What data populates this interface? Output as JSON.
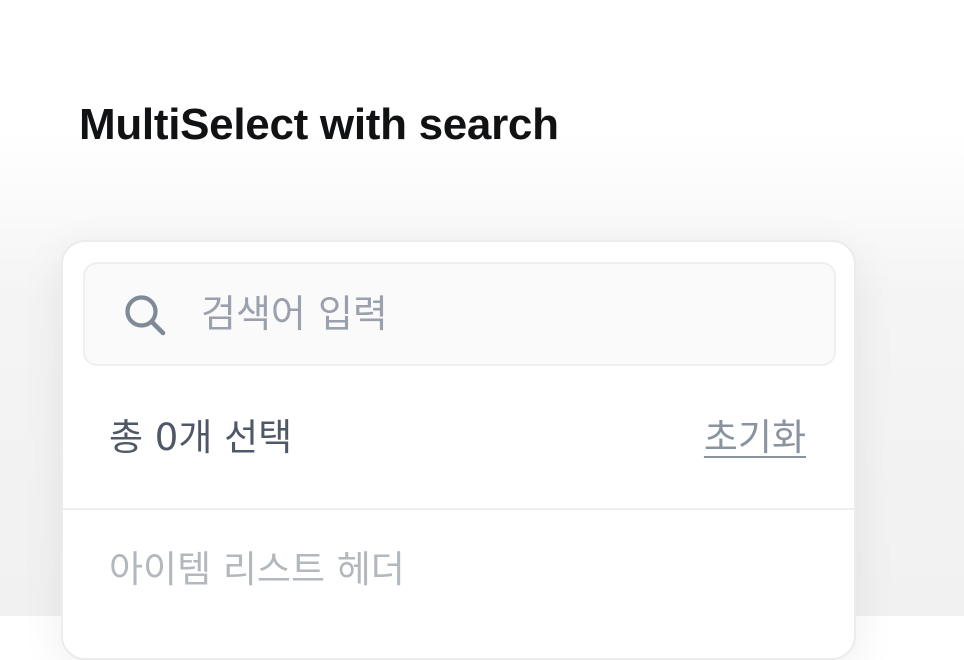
{
  "page": {
    "title": "MultiSelect with search"
  },
  "search": {
    "placeholder": "검색어 입력",
    "value": "",
    "icon": "search-icon"
  },
  "summary": {
    "selected_text": "총 0개 선택",
    "selected_count": 0,
    "reset_label": "초기화"
  },
  "list": {
    "header": "아이템 리스트 헤더",
    "items": []
  },
  "colors": {
    "title": "#111214",
    "placeholder": "#9aa1ad",
    "summary_text": "#4e5867",
    "reset_link": "#8a93a0",
    "list_header": "#b3b7be",
    "panel_border": "#ececec",
    "search_bg": "#fafafa"
  }
}
